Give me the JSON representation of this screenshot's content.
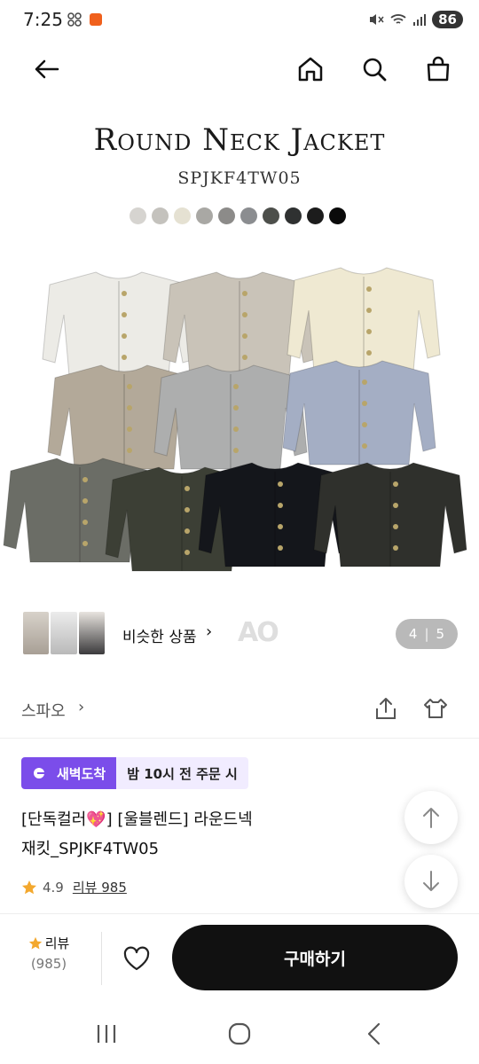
{
  "status_bar": {
    "time": "7:25",
    "battery": "86",
    "notification_icons": [
      "grid-app-icon",
      "orange-app-icon"
    ]
  },
  "nav": {
    "icons": [
      "back-arrow-icon",
      "home-icon",
      "search-icon",
      "shopping-bag-icon"
    ]
  },
  "product_image": {
    "title": "Round Neck Jacket",
    "code": "SPJKF4TW05",
    "swatch_colors": [
      "#d6d4d0",
      "#c4c2bd",
      "#e5e1d2",
      "#a9a8a4",
      "#8c8b89",
      "#8b8d90",
      "#4d4f4b",
      "#2f3131",
      "#1c1c1c",
      "#0a0a0a"
    ],
    "jackets": [
      {
        "color": "#ecebe6",
        "name": "ivory"
      },
      {
        "color": "#c9c3b8",
        "name": "oatmeal"
      },
      {
        "color": "#efe9d2",
        "name": "cream"
      },
      {
        "color": "#b3a999",
        "name": "beige"
      },
      {
        "color": "#adaeae",
        "name": "light-gray"
      },
      {
        "color": "#a4aec4",
        "name": "blue-gray"
      },
      {
        "color": "#6b6d66",
        "name": "charcoal-tweed"
      },
      {
        "color": "#3c3f35",
        "name": "olive"
      },
      {
        "color": "#14161b",
        "name": "black"
      },
      {
        "color": "#2f302c",
        "name": "dark-gray"
      }
    ]
  },
  "similar": {
    "label": "비슷한 상품",
    "page_current": "4",
    "page_total": "5",
    "watermark": "AO"
  },
  "brand": {
    "name": "스파오"
  },
  "delivery": {
    "badge": "새벽도착",
    "time": "밤 10시 전 주문 시"
  },
  "product": {
    "title_line1": "[단독컬러💖] [울블렌드] 라운드넥",
    "title_line2": "재킷_SPJKF4TW05",
    "rating": "4.9",
    "review_link": "리뷰 985"
  },
  "buy_bar": {
    "review_label": "리뷰",
    "review_count": "(985)",
    "buy_label": "구매하기"
  }
}
